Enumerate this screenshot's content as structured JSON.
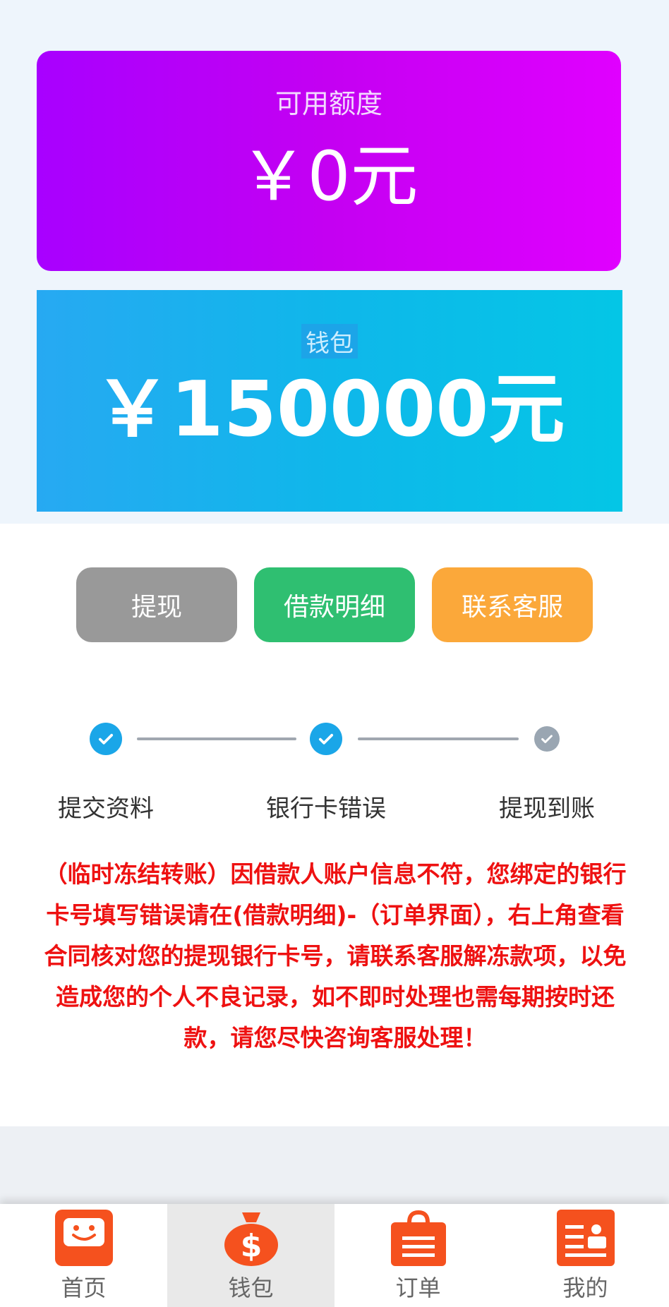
{
  "credit": {
    "label": "可用额度",
    "amount": "￥0元"
  },
  "wallet": {
    "label": "钱包",
    "amount": "￥150000元"
  },
  "actions": {
    "withdraw": "提现",
    "loan_detail": "借款明细",
    "contact_service": "联系客服"
  },
  "steps": [
    {
      "label": "提交资料",
      "status": "done"
    },
    {
      "label": "银行卡错误",
      "status": "done"
    },
    {
      "label": "提现到账",
      "status": "pending"
    }
  ],
  "notice": "（临时冻结转账）因借款人账户信息不符，您绑定的银行卡号填写错误请在(借款明细)-（订单界面），右上角查看合同核对您的提现银行卡号，请联系客服解冻款项，以免造成您的个人不良记录，如不即时处理也需每期按时还款，请您尽快咨询客服处理！",
  "tabbar": {
    "home": "首页",
    "wallet": "钱包",
    "orders": "订单",
    "mine": "我的",
    "active": "wallet"
  },
  "colors": {
    "credit_card_gradient": [
      "#a800ff",
      "#e000ff"
    ],
    "wallet_card_gradient": [
      "#27a9f2",
      "#04c6e6"
    ],
    "button_gray": "#999999",
    "button_green": "#2fbf71",
    "button_orange": "#fba83a",
    "notice_red": "#ee1111",
    "tab_icon_orange": "#f5511e",
    "step_done": "#1aa6e8",
    "step_pending": "#9aa6b2"
  }
}
